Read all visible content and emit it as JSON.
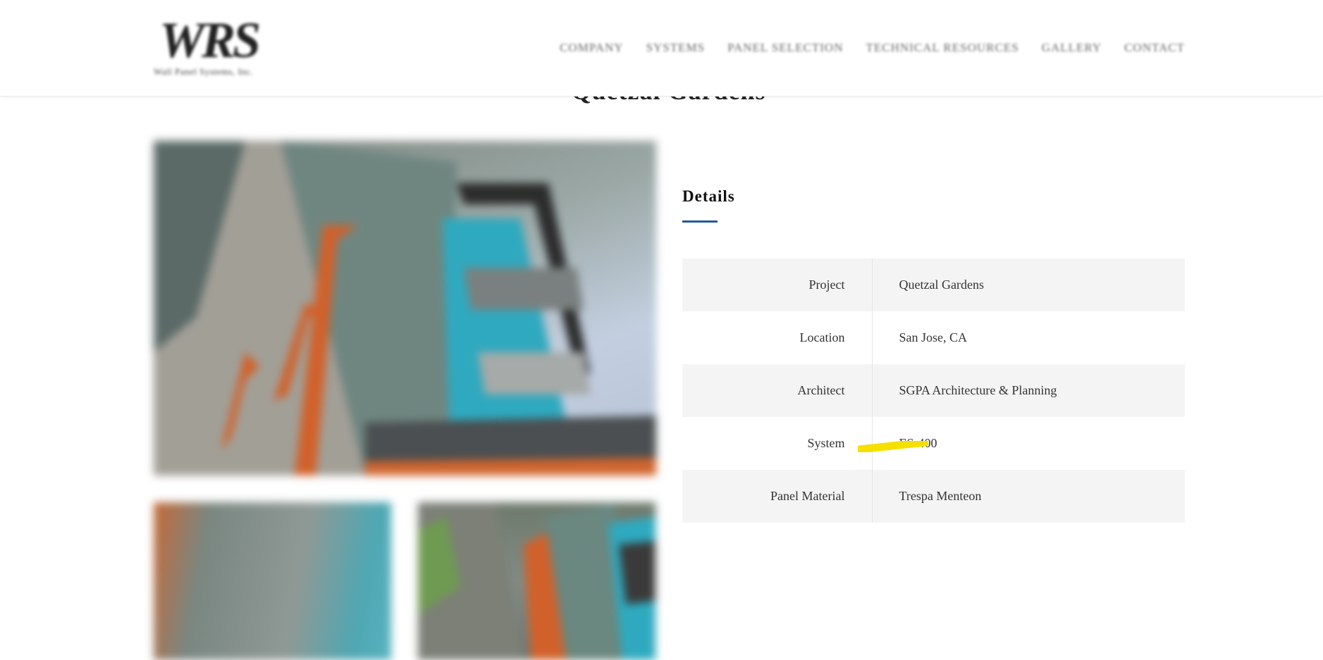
{
  "header": {
    "logo": {
      "mark": "WRS",
      "subtitle": "Wall Panel Systems, Inc."
    },
    "nav": [
      {
        "label": "COMPANY"
      },
      {
        "label": "SYSTEMS"
      },
      {
        "label": "PANEL SELECTION"
      },
      {
        "label": "TECHNICAL RESOURCES"
      },
      {
        "label": "GALLERY"
      },
      {
        "label": "CONTACT"
      }
    ]
  },
  "page": {
    "title": "Quetzal Gardens"
  },
  "details": {
    "heading": "Details",
    "accent_color": "#1e5a96",
    "rows": [
      {
        "label": "Project",
        "value": "Quetzal Gardens"
      },
      {
        "label": "Location",
        "value": "San Jose, CA"
      },
      {
        "label": "Architect",
        "value": "SGPA Architecture & Planning"
      },
      {
        "label": "System",
        "value": "ES-400"
      },
      {
        "label": "Panel Material",
        "value": "Trespa Menteon"
      }
    ]
  },
  "annotation": {
    "highlight_color": "#f5e000"
  }
}
